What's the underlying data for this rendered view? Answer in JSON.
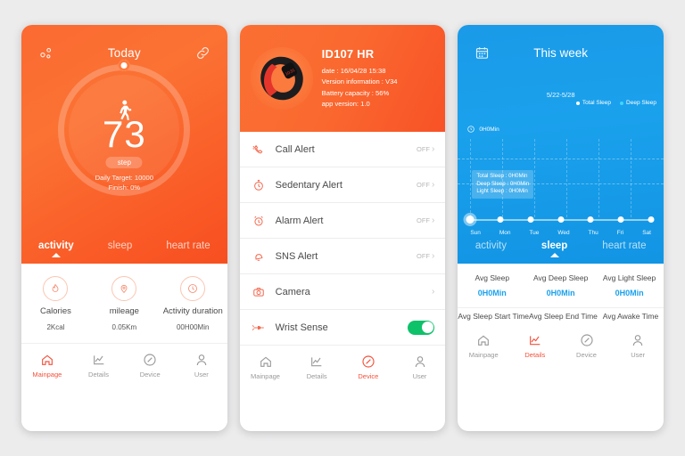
{
  "phone1": {
    "header": {
      "share_icon": "share-icon",
      "title": "Today",
      "caret": "⌄",
      "link_icon": "link-icon"
    },
    "ring": {
      "walk_icon": "walking-icon",
      "steps": "73",
      "unit_pill": "step",
      "daily_target": "Daily Target: 10000",
      "finish": "Finish: 0%"
    },
    "tabs": [
      {
        "label": "activity",
        "active": true
      },
      {
        "label": "sleep",
        "active": false
      },
      {
        "label": "heart rate",
        "active": false
      }
    ],
    "stats": [
      {
        "icon": "flame-icon",
        "label": "Calories",
        "value": "2Kcal"
      },
      {
        "icon": "pin-icon",
        "label": "mileage",
        "value": "0.05Km"
      },
      {
        "icon": "clock-icon",
        "label": "Activity duration",
        "value": "00H00Min"
      }
    ],
    "nav": [
      {
        "icon": "home-icon",
        "label": "Mainpage",
        "active": true
      },
      {
        "icon": "chart-icon",
        "label": "Details",
        "active": false
      },
      {
        "icon": "compass-icon",
        "label": "Device",
        "active": false
      },
      {
        "icon": "user-icon",
        "label": "User",
        "active": false
      }
    ]
  },
  "phone2": {
    "device": {
      "image": "fitness-band-image",
      "name": "ID107 HR",
      "date": "date : 16/04/28 15:38",
      "version": "Version information : V34",
      "battery": "Battery capacity : 56%",
      "app_version": "app version: 1.0"
    },
    "rows": [
      {
        "icon": "phone-call-icon",
        "label": "Call Alert",
        "value": "OFF",
        "control": "chevron"
      },
      {
        "icon": "stopwatch-icon",
        "label": "Sedentary Alert",
        "value": "OFF",
        "control": "chevron"
      },
      {
        "icon": "alarm-clock-icon",
        "label": "Alarm Alert",
        "value": "OFF",
        "control": "chevron"
      },
      {
        "icon": "bell-icon",
        "label": "SNS Alert",
        "value": "OFF",
        "control": "chevron"
      },
      {
        "icon": "camera-icon",
        "label": "Camera",
        "value": "",
        "control": "chevron"
      },
      {
        "icon": "hand-point-icon",
        "label": "Wrist Sense",
        "value": "",
        "control": "toggle-on"
      }
    ],
    "chevron": "›",
    "nav": [
      {
        "icon": "home-icon",
        "label": "Mainpage",
        "active": false
      },
      {
        "icon": "chart-icon",
        "label": "Details",
        "active": false
      },
      {
        "icon": "compass-icon",
        "label": "Device",
        "active": true
      },
      {
        "icon": "user-icon",
        "label": "User",
        "active": false
      }
    ]
  },
  "phone3": {
    "header": {
      "calendar_icon": "calendar-icon",
      "title": "This week",
      "date_range": "5/22-5/28"
    },
    "legend": [
      {
        "label": "Total Sleep",
        "color": "#ffffff"
      },
      {
        "label": "Deep Sleep",
        "color": "#3fd6ff"
      }
    ],
    "y_label": {
      "icon": "moon-icon",
      "text": "0H0Min"
    },
    "tooltip": [
      "Total Sleep : 0H0Min",
      "Deep Sleep : 0H0Min",
      "Light Sleep : 0H0Min"
    ],
    "tabs": [
      {
        "label": "activity",
        "active": false
      },
      {
        "label": "sleep",
        "active": true
      },
      {
        "label": "heart rate",
        "active": false
      }
    ],
    "stats_row1": [
      {
        "label": "Avg Sleep",
        "value": "0H0Min"
      },
      {
        "label": "Avg Deep Sleep",
        "value": "0H0Min"
      },
      {
        "label": "Avg Light Sleep",
        "value": "0H0Min"
      }
    ],
    "stats_row2": [
      {
        "label": "Avg Sleep Start Time",
        "value": ""
      },
      {
        "label": "Avg Sleep End Time",
        "value": ""
      },
      {
        "label": "Avg Awake Time",
        "value": ""
      }
    ],
    "nav": [
      {
        "icon": "home-icon",
        "label": "Mainpage",
        "active": false
      },
      {
        "icon": "chart-icon",
        "label": "Details",
        "active": true
      },
      {
        "icon": "compass-icon",
        "label": "Device",
        "active": false
      },
      {
        "icon": "user-icon",
        "label": "User",
        "active": false
      }
    ],
    "chart_data": {
      "type": "line",
      "title": "This week",
      "subtitle": "5/22-5/28",
      "categories": [
        "Sun",
        "Mon",
        "Tue",
        "Wed",
        "Thu",
        "Fri",
        "Sat"
      ],
      "series": [
        {
          "name": "Total Sleep",
          "values": [
            0,
            0,
            0,
            0,
            0,
            0,
            0
          ],
          "color": "#ffffff"
        },
        {
          "name": "Deep Sleep",
          "values": [
            0,
            0,
            0,
            0,
            0,
            0,
            0
          ],
          "color": "#3fd6ff"
        }
      ],
      "ylabel": "0H0Min",
      "ylim": [
        0,
        0
      ],
      "grid": true,
      "legend_position": "top-right",
      "selected_index": 0
    }
  }
}
